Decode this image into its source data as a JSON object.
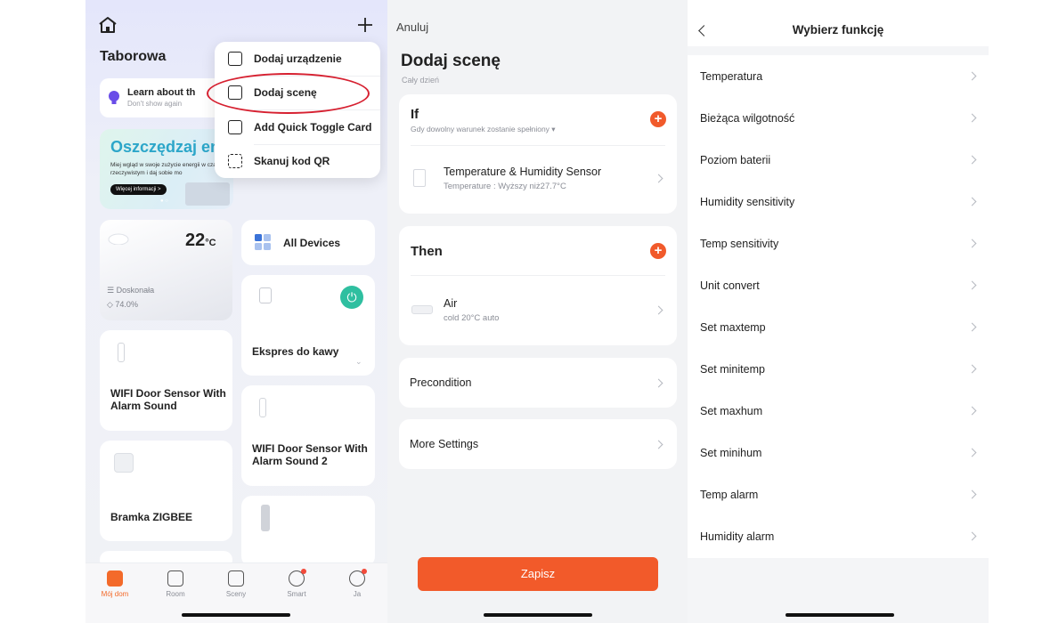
{
  "home": {
    "name": "Taborowa",
    "learn_title": "Learn about th",
    "learn_sub": "Don't show again",
    "banner_title": "Oszczędzaj en",
    "banner_text": "Miej wgląd w swoje zużycie energii w czasie rzeczywistym i daj sobie mo",
    "banner_button": "Więcej informacji >",
    "weather_temp": "22",
    "weather_unit": "°C",
    "weather_quality": "Doskonała",
    "weather_humidity": "74.0%",
    "all_devices": "All Devices",
    "devices": [
      {
        "name": "Ekspres do kawy"
      },
      {
        "name": "WIFI Door Sensor With Alarm Sound"
      },
      {
        "name": "WIFI Door Sensor With Alarm Sound 2"
      },
      {
        "name": "Bramka ZIGBEE"
      }
    ],
    "menu": [
      {
        "label": "Dodaj urządzenie",
        "icon": "add-device-icon"
      },
      {
        "label": "Dodaj scenę",
        "icon": "add-scene-icon"
      },
      {
        "label": "Add Quick Toggle Card",
        "icon": "add-card-icon"
      },
      {
        "label": "Skanuj kod QR",
        "icon": "scan-icon"
      }
    ],
    "tabs": [
      {
        "label": "Mój dom",
        "active": true
      },
      {
        "label": "Room"
      },
      {
        "label": "Sceny"
      },
      {
        "label": "Smart",
        "dot": true
      },
      {
        "label": "Ja",
        "dot": true
      }
    ]
  },
  "scene": {
    "cancel": "Anuluj",
    "title": "Dodaj scenę",
    "subtitle": "Cały dzień",
    "if_title": "If",
    "if_sub": "Gdy dowolny warunek zostanie spełniony",
    "if_device": "Temperature & Humidity Sensor",
    "if_condition": "Temperature : Wyższy niż27.7°C",
    "then_title": "Then",
    "then_device": "Air",
    "then_action": "cold 20°C auto",
    "precondition": "Precondition",
    "more_settings": "More Settings",
    "save": "Zapisz"
  },
  "functions": {
    "title": "Wybierz funkcję",
    "items": [
      "Temperatura",
      "Bieżąca wilgotność",
      "Poziom baterii",
      "Humidity sensitivity",
      "Temp sensitivity",
      "Unit convert",
      "Set maxtemp",
      "Set minitemp",
      "Set maxhum",
      "Set minihum",
      "Temp alarm",
      "Humidity alarm"
    ]
  },
  "colors": {
    "accent": "#f25a2a",
    "highlight": "#d62030",
    "power": "#2fbfa0"
  }
}
